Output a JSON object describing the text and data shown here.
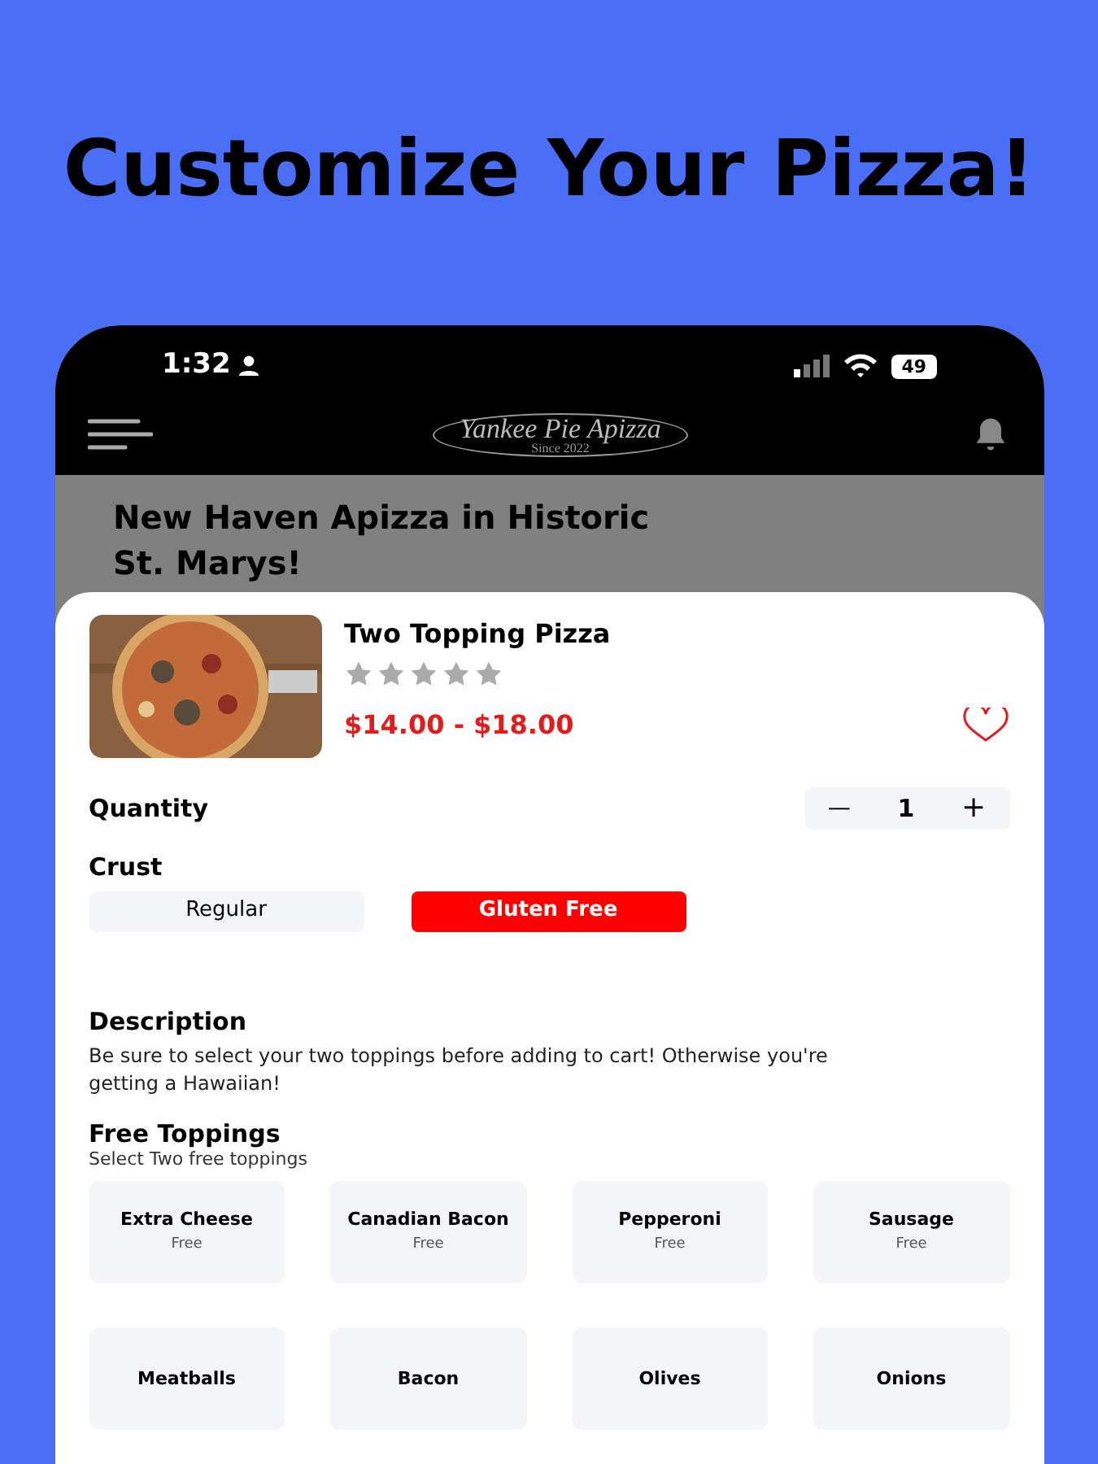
{
  "headline": "Customize Your Pizza!",
  "status_bar": {
    "time": "1:32",
    "battery": "49"
  },
  "app_bar": {
    "logo_title": "Yankee Pie Apizza",
    "logo_subtitle": "Since 2022"
  },
  "banner": {
    "title": "New Haven Apizza in Historic St. Marys!"
  },
  "product": {
    "name": "Two Topping Pizza",
    "stars": 0,
    "price": "$14.00 - $18.00",
    "favorite": false
  },
  "quantity": {
    "label": "Quantity",
    "minus": "—",
    "value": "1",
    "plus": "+"
  },
  "crust": {
    "label": "Crust",
    "options": [
      {
        "label": "Regular",
        "selected": false
      },
      {
        "label": "Gluten Free",
        "selected": true
      }
    ]
  },
  "description": {
    "title": "Description",
    "text": "Be sure to select your two toppings before adding to cart! Otherwise you're getting a Hawaiian!"
  },
  "toppings": {
    "title": "Free Toppings",
    "subtitle": "Select Two free toppings",
    "items": [
      {
        "name": "Extra Cheese",
        "price": "Free"
      },
      {
        "name": "Canadian Bacon",
        "price": "Free"
      },
      {
        "name": "Pepperoni",
        "price": "Free"
      },
      {
        "name": "Sausage",
        "price": "Free"
      },
      {
        "name": "Meatballs"
      },
      {
        "name": "Bacon"
      },
      {
        "name": "Olives"
      },
      {
        "name": "Onions"
      }
    ]
  }
}
